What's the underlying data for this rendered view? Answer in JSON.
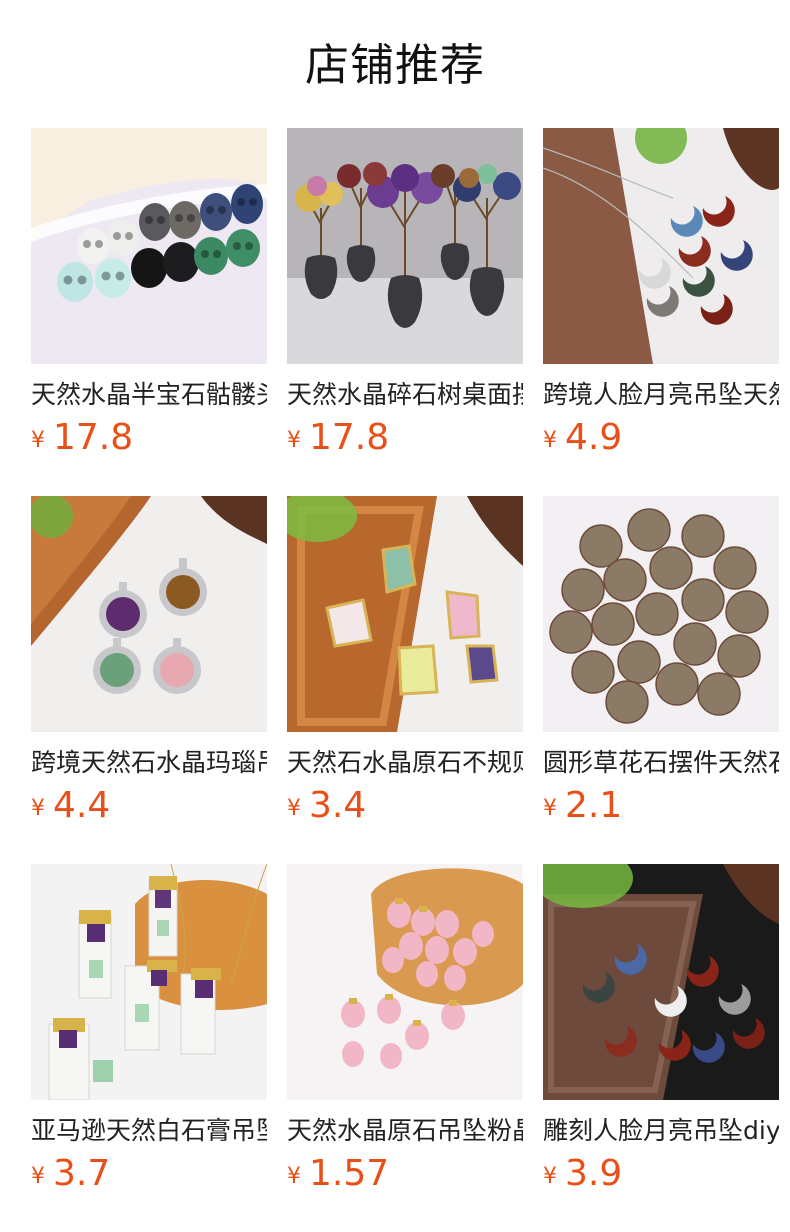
{
  "header": {
    "title": "店铺推荐"
  },
  "currency_symbol": "¥",
  "colors": {
    "price": "#e8501a",
    "title": "#111111",
    "text": "#222222"
  },
  "products": [
    {
      "name": "天然水晶半宝石骷髅头摆件",
      "price": "17.8",
      "image": "crystal-skulls"
    },
    {
      "name": "天然水晶碎石树桌面摆件",
      "price": "17.8",
      "image": "crystal-trees"
    },
    {
      "name": "跨境人脸月亮吊坠天然石",
      "price": "4.9",
      "image": "moon-face-pendants"
    },
    {
      "name": "跨境天然石水晶玛瑙吊坠",
      "price": "4.4",
      "image": "round-pendants"
    },
    {
      "name": "天然石水晶原石不规则吊坠",
      "price": "3.4",
      "image": "raw-stone-pendants"
    },
    {
      "name": "圆形草花石摆件天然石球",
      "price": "2.1",
      "image": "stone-spheres"
    },
    {
      "name": "亚马逊天然白石膏吊坠",
      "price": "3.7",
      "image": "selenite-pendants"
    },
    {
      "name": "天然水晶原石吊坠粉晶",
      "price": "1.57",
      "image": "rose-quartz-drops"
    },
    {
      "name": "雕刻人脸月亮吊坠diy",
      "price": "3.9",
      "image": "carved-moon-pendants"
    }
  ]
}
